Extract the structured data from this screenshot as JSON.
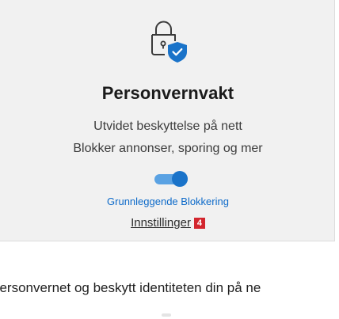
{
  "icon": "lock-with-shield-icon",
  "card": {
    "title": "Personvernvakt",
    "description_line1": "Utvidet beskyttelse på nett",
    "description_line2": "Blokker annonser, sporing og mer",
    "toggle_state": "on",
    "protection_level": "Grunnleggende Blokkering",
    "settings_label": "Innstillinger",
    "badge_number": "4"
  },
  "footer": {
    "text": "personvernet og beskytt identiteten din på ne"
  },
  "colors": {
    "accent": "#1a73c9",
    "toggle_track": "#5aa2e3",
    "card_background": "#f1f1f1",
    "badge": "#d3262e"
  }
}
